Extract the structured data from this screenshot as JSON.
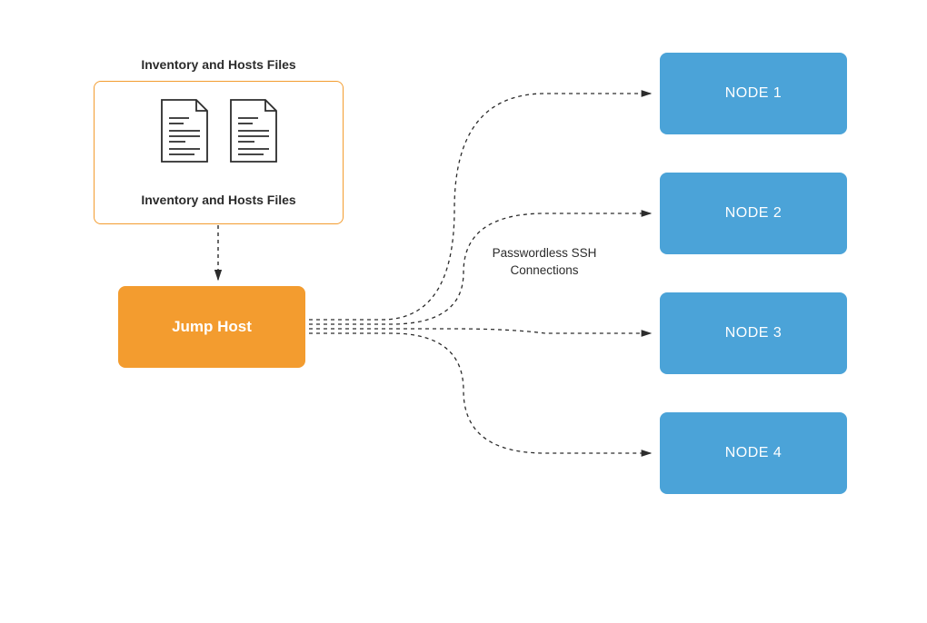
{
  "diagram": {
    "inventory": {
      "title_top": "Inventory and Hosts Files",
      "title_inside": "Inventory and Hosts Files"
    },
    "jump_host": {
      "label": "Jump Host"
    },
    "ssh_label_line1": "Passwordless SSH",
    "ssh_label_line2": "Connections",
    "nodes": {
      "n1": "NODE 1",
      "n2": "NODE 2",
      "n3": "NODE 3",
      "n4": "NODE 4"
    },
    "colors": {
      "orange": "#f39c2f",
      "blue": "#4ba3d8",
      "text": "#2c2c2c"
    }
  }
}
